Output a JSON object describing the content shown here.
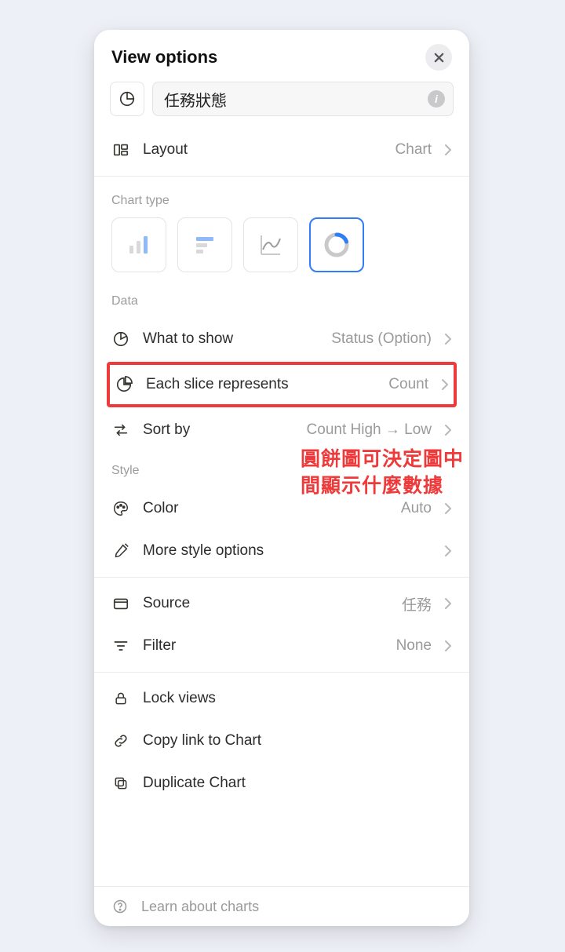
{
  "header": {
    "title": "View options"
  },
  "view": {
    "title": "任務狀態",
    "layout_label": "Layout",
    "layout_value": "Chart"
  },
  "sections": {
    "chart_type_label": "Chart type",
    "data_label": "Data",
    "style_label": "Style"
  },
  "data_rows": {
    "what_to_show_label": "What to show",
    "what_to_show_value": "Status (Option)",
    "each_slice_label": "Each slice represents",
    "each_slice_value": "Count",
    "sort_by_label": "Sort by",
    "sort_by_value": "Count High → Low"
  },
  "style_rows": {
    "color_label": "Color",
    "color_value": "Auto",
    "more_style_label": "More style options"
  },
  "source_rows": {
    "source_label": "Source",
    "source_value": "任務",
    "filter_label": "Filter",
    "filter_value": "None"
  },
  "actions": {
    "lock_views": "Lock views",
    "copy_link": "Copy link to Chart",
    "duplicate": "Duplicate Chart"
  },
  "footer": {
    "learn": "Learn about charts"
  },
  "annotation": {
    "line1": "圓餅圖可決定圖中",
    "line2": "間顯示什麼數據"
  }
}
